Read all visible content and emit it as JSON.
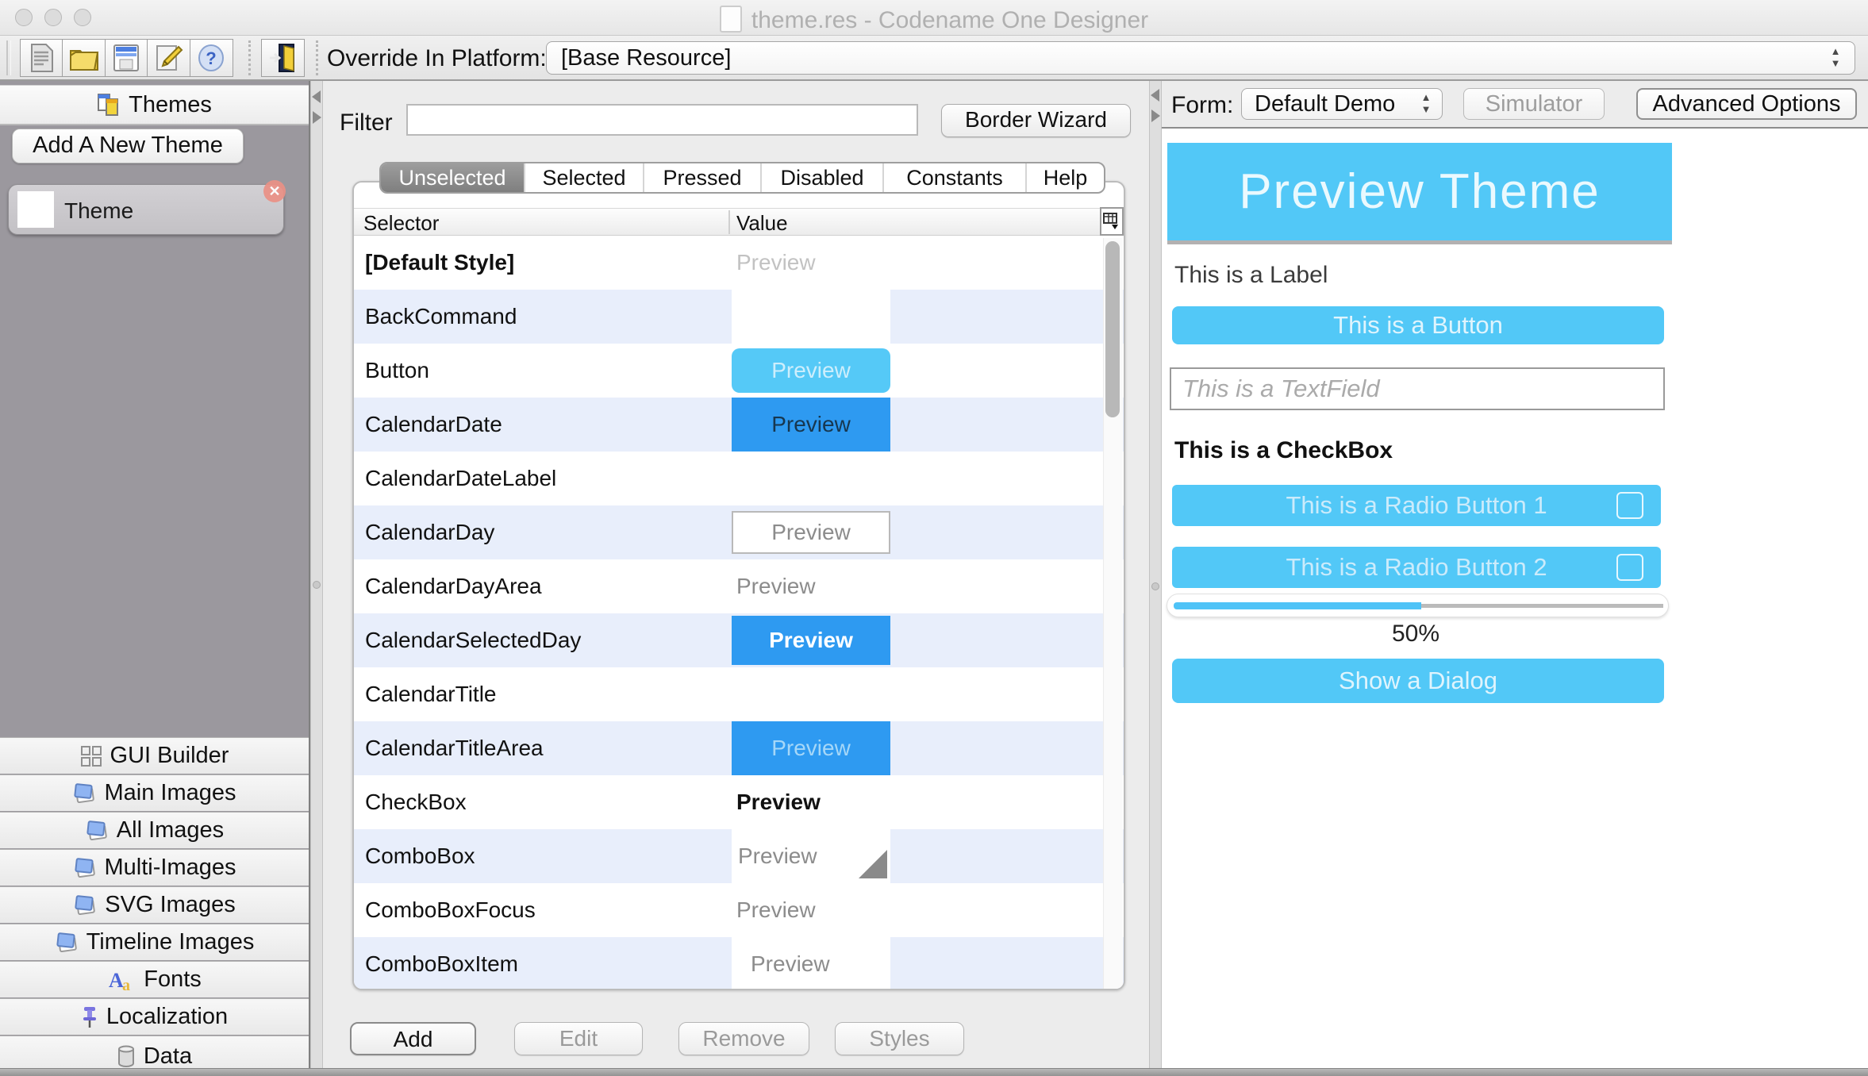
{
  "window": {
    "title": "theme.res - Codename One Designer"
  },
  "toolbar": {
    "override_label": "Override In Platform:",
    "override_value": "[Base Resource]",
    "buttons": [
      {
        "name": "new-resource"
      },
      {
        "name": "open-resource"
      },
      {
        "name": "save-resource"
      },
      {
        "name": "edit-resource"
      },
      {
        "name": "help"
      },
      {
        "name": "exit"
      }
    ]
  },
  "sidebar": {
    "themes_header": "Themes",
    "add_theme_button": "Add A New Theme",
    "theme_item": {
      "label": "Theme"
    },
    "nav_items": [
      {
        "label": "GUI Builder"
      },
      {
        "label": "Main Images"
      },
      {
        "label": "All Images"
      },
      {
        "label": "Multi-Images"
      },
      {
        "label": "SVG Images"
      },
      {
        "label": "Timeline Images"
      },
      {
        "label": "Fonts"
      },
      {
        "label": "Localization"
      },
      {
        "label": "Data"
      }
    ]
  },
  "editor": {
    "filter_label": "Filter",
    "filter_value": "",
    "border_wizard_button": "Border Wizard",
    "tabs": [
      {
        "label": "Unselected",
        "selected": true
      },
      {
        "label": "Selected",
        "selected": false
      },
      {
        "label": "Pressed",
        "selected": false
      },
      {
        "label": "Disabled",
        "selected": false
      },
      {
        "label": "Constants",
        "selected": false
      },
      {
        "label": "Help",
        "selected": false
      }
    ],
    "table": {
      "columns": [
        "Selector",
        "Value"
      ],
      "rows": [
        {
          "selector": "[Default Style]",
          "value_type": "plain-gray-text",
          "value_text": "Preview"
        },
        {
          "selector": "BackCommand",
          "value_type": "empty-white-cell",
          "value_text": ""
        },
        {
          "selector": "Button",
          "value_type": "light-blue-button",
          "value_text": "Preview"
        },
        {
          "selector": "CalendarDate",
          "value_type": "blue-fill-dark-text",
          "value_text": "Preview"
        },
        {
          "selector": "CalendarDateLabel",
          "value_type": "none",
          "value_text": ""
        },
        {
          "selector": "CalendarDay",
          "value_type": "white-bordered-button",
          "value_text": "Preview"
        },
        {
          "selector": "CalendarDayArea",
          "value_type": "plain-gray-text",
          "value_text": "Preview"
        },
        {
          "selector": "CalendarSelectedDay",
          "value_type": "blue-button-bold-white",
          "value_text": "Preview"
        },
        {
          "selector": "CalendarTitle",
          "value_type": "none",
          "value_text": ""
        },
        {
          "selector": "CalendarTitleArea",
          "value_type": "blue-fill-light-text",
          "value_text": "Preview"
        },
        {
          "selector": "CheckBox",
          "value_type": "bold-black-text",
          "value_text": "Preview"
        },
        {
          "selector": "ComboBox",
          "value_type": "combo-white-cell",
          "value_text": "Preview"
        },
        {
          "selector": "ComboBoxFocus",
          "value_type": "plain-gray-text",
          "value_text": "Preview"
        },
        {
          "selector": "ComboBoxItem",
          "value_type": "white-cell-gray-text",
          "value_text": "Preview"
        }
      ]
    },
    "action_buttons": [
      {
        "label": "Add"
      },
      {
        "label": "Edit"
      },
      {
        "label": "Remove"
      },
      {
        "label": "Styles"
      }
    ]
  },
  "preview": {
    "form_label": "Form:",
    "form_value": "Default Demo",
    "simulator_button": "Simulator",
    "advanced_options_button": "Advanced Options",
    "title": "Preview Theme",
    "label": "This is a Label",
    "button": "This is a Button",
    "textfield_placeholder": "This is a TextField",
    "checkbox": "This is a CheckBox",
    "radio1": "This is a Radio Button 1",
    "radio2": "This is a Radio Button 2",
    "progress_percent": 50,
    "progress_label": "50%",
    "dialog_button": "Show a Dialog"
  },
  "colors": {
    "accent_light_blue": "#52C8F7",
    "accent_blue": "#2E9AF1",
    "table_alt_row": "#E8EEFB",
    "sidebar_gray": "#9B989E"
  }
}
